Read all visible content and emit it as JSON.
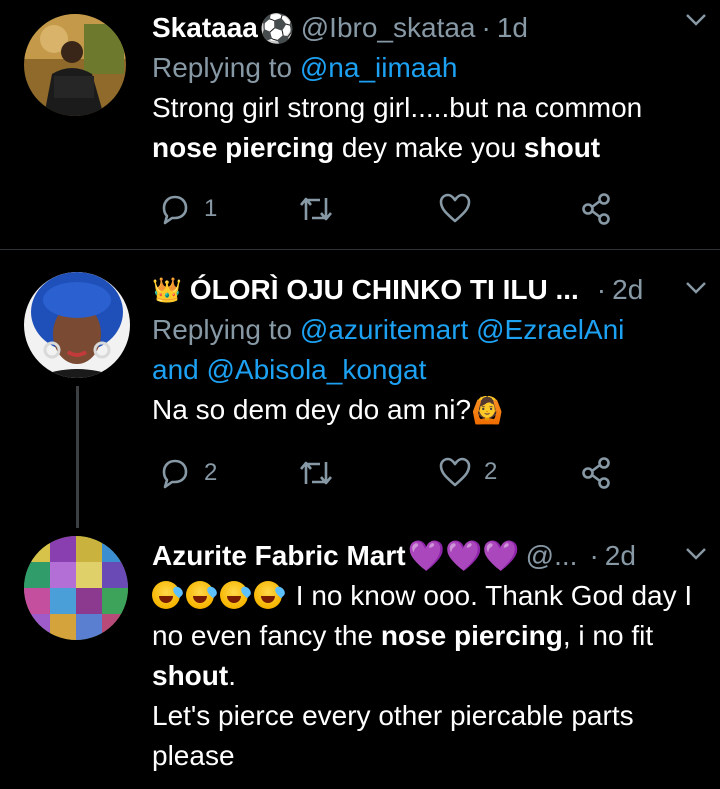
{
  "tweets": [
    {
      "name": "Skataaa",
      "name_emoji": "⚽",
      "handle": "@Ibro_skataa",
      "time": "1d",
      "replying_label": "Replying to",
      "replying_to": "@na_iimaah",
      "text_parts": [
        "Strong girl strong girl.....but na common ",
        "nose piercing",
        " dey make you ",
        "shout"
      ],
      "replies": "1",
      "retweets": "",
      "likes": ""
    },
    {
      "name_prefix_emoji": "👑",
      "name": "ÓLORÌ OJU CHINKO TI ILU ...",
      "handle": "",
      "time": "2d",
      "replying_label": "Replying to",
      "replying_to_1": "@azuritemart",
      "replying_to_2": "@EzraelAni",
      "replying_and": "and",
      "replying_to_3": "@Abisola_kongat",
      "text": "Na so dem dey do am ni?",
      "text_emoji": "🙆",
      "replies": "2",
      "retweets": "",
      "likes": "2"
    },
    {
      "name": "Azurite Fabric Mart",
      "name_emoji": "💜💜💜",
      "handle": "@...",
      "time": "2d",
      "text_parts": [
        " I no know ooo. Thank God day I no even fancy the ",
        "nose piercing",
        ", i no fit ",
        "shout",
        "."
      ],
      "text_line2": "Let's pierce every other piercable parts please"
    }
  ],
  "icons": {
    "reply": "reply-icon",
    "retweet": "retweet-icon",
    "like": "heart-icon",
    "share": "share-icon",
    "more": "chevron-down-icon"
  },
  "colors": {
    "background": "#000000",
    "secondary_text": "#8899a6",
    "link": "#1da1f2",
    "divider": "#2f3336"
  }
}
